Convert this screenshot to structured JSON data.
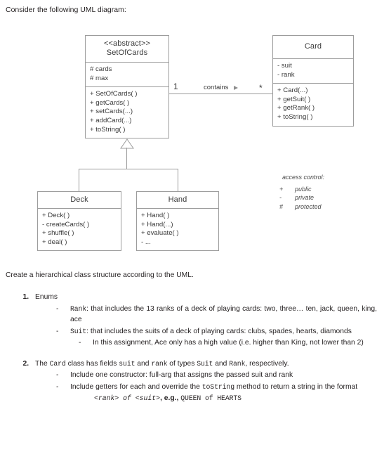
{
  "intro": "Consider the following UML diagram:",
  "diagram": {
    "classes": [
      {
        "id": "setofcards",
        "stereotype": "<<abstract>>",
        "name": "SetOfCards",
        "attributes": [
          "# cards",
          "# max"
        ],
        "operations": [
          "+ SetOfCards( )",
          "+ getCards( )",
          "+ setCards(...)",
          "+ addCard(...)",
          "+ toString( )"
        ]
      },
      {
        "id": "card",
        "stereotype": "",
        "name": "Card",
        "attributes": [
          "- suit",
          "- rank"
        ],
        "operations": [
          "+ Card(...)",
          "+ getSuit( )",
          "+ getRank( )",
          "+ toString( )"
        ]
      },
      {
        "id": "deck",
        "stereotype": "",
        "name": "Deck",
        "attributes": [],
        "operations": [
          "+ Deck( )",
          "- createCards( )",
          "+ shuffle( )",
          "+ deal( )"
        ]
      },
      {
        "id": "hand",
        "stereotype": "",
        "name": "Hand",
        "attributes": [],
        "operations": [
          "+ Hand( )",
          "+ Hand(...)",
          "+ evaluate( )",
          "- ..."
        ]
      }
    ],
    "association": {
      "label": "contains",
      "multiplicity_source": "1",
      "multiplicity_target": "*",
      "arrow": "filled-right-triangle"
    },
    "legend": {
      "title": "access control:",
      "rows": [
        {
          "symbol": "+",
          "meaning": "public"
        },
        {
          "symbol": "-",
          "meaning": "private"
        },
        {
          "symbol": "#",
          "meaning": "protected"
        }
      ]
    }
  },
  "instructions": {
    "lead": "Create a hierarchical class structure according to the UML.",
    "item1": {
      "heading": "Enums",
      "rank_code": "Rank",
      "rank_text": ": that includes the 13 ranks of a deck of playing cards: two, three… ten, jack, queen, king, ace",
      "suit_code": "Suit",
      "suit_text": ": that includes the suits of a deck of playing cards: clubs, spades, hearts, diamonds",
      "ace_note": "In this assignment, Ace only has a high value (i.e. higher than King, not lower than 2)"
    },
    "item2": {
      "p1": "The ",
      "card_code": "Card",
      "p2": " class has fields ",
      "suit_code": "suit",
      "p3": " and ",
      "rank_code": "rank",
      "p4": " of types ",
      "suit_type": "Suit",
      "p5": " and ",
      "rank_type": "Rank",
      "p6": ", respectively.",
      "bullet1": "Include one constructor:  full-arg that assigns the passed suit and rank",
      "bullet2_pre": "Include getters for each and override the ",
      "bullet2_code": "toString",
      "bullet2_post": " method to return a string in the format",
      "format_code": "<rank> of <suit>",
      "format_eg": ", e.g., ",
      "format_example": "QUEEN of HEARTS"
    }
  },
  "colors": {
    "box_border": "#9c9c9c",
    "text": "#231f20",
    "diagram_text": "#3a3a3a",
    "background": "#ffffff"
  }
}
